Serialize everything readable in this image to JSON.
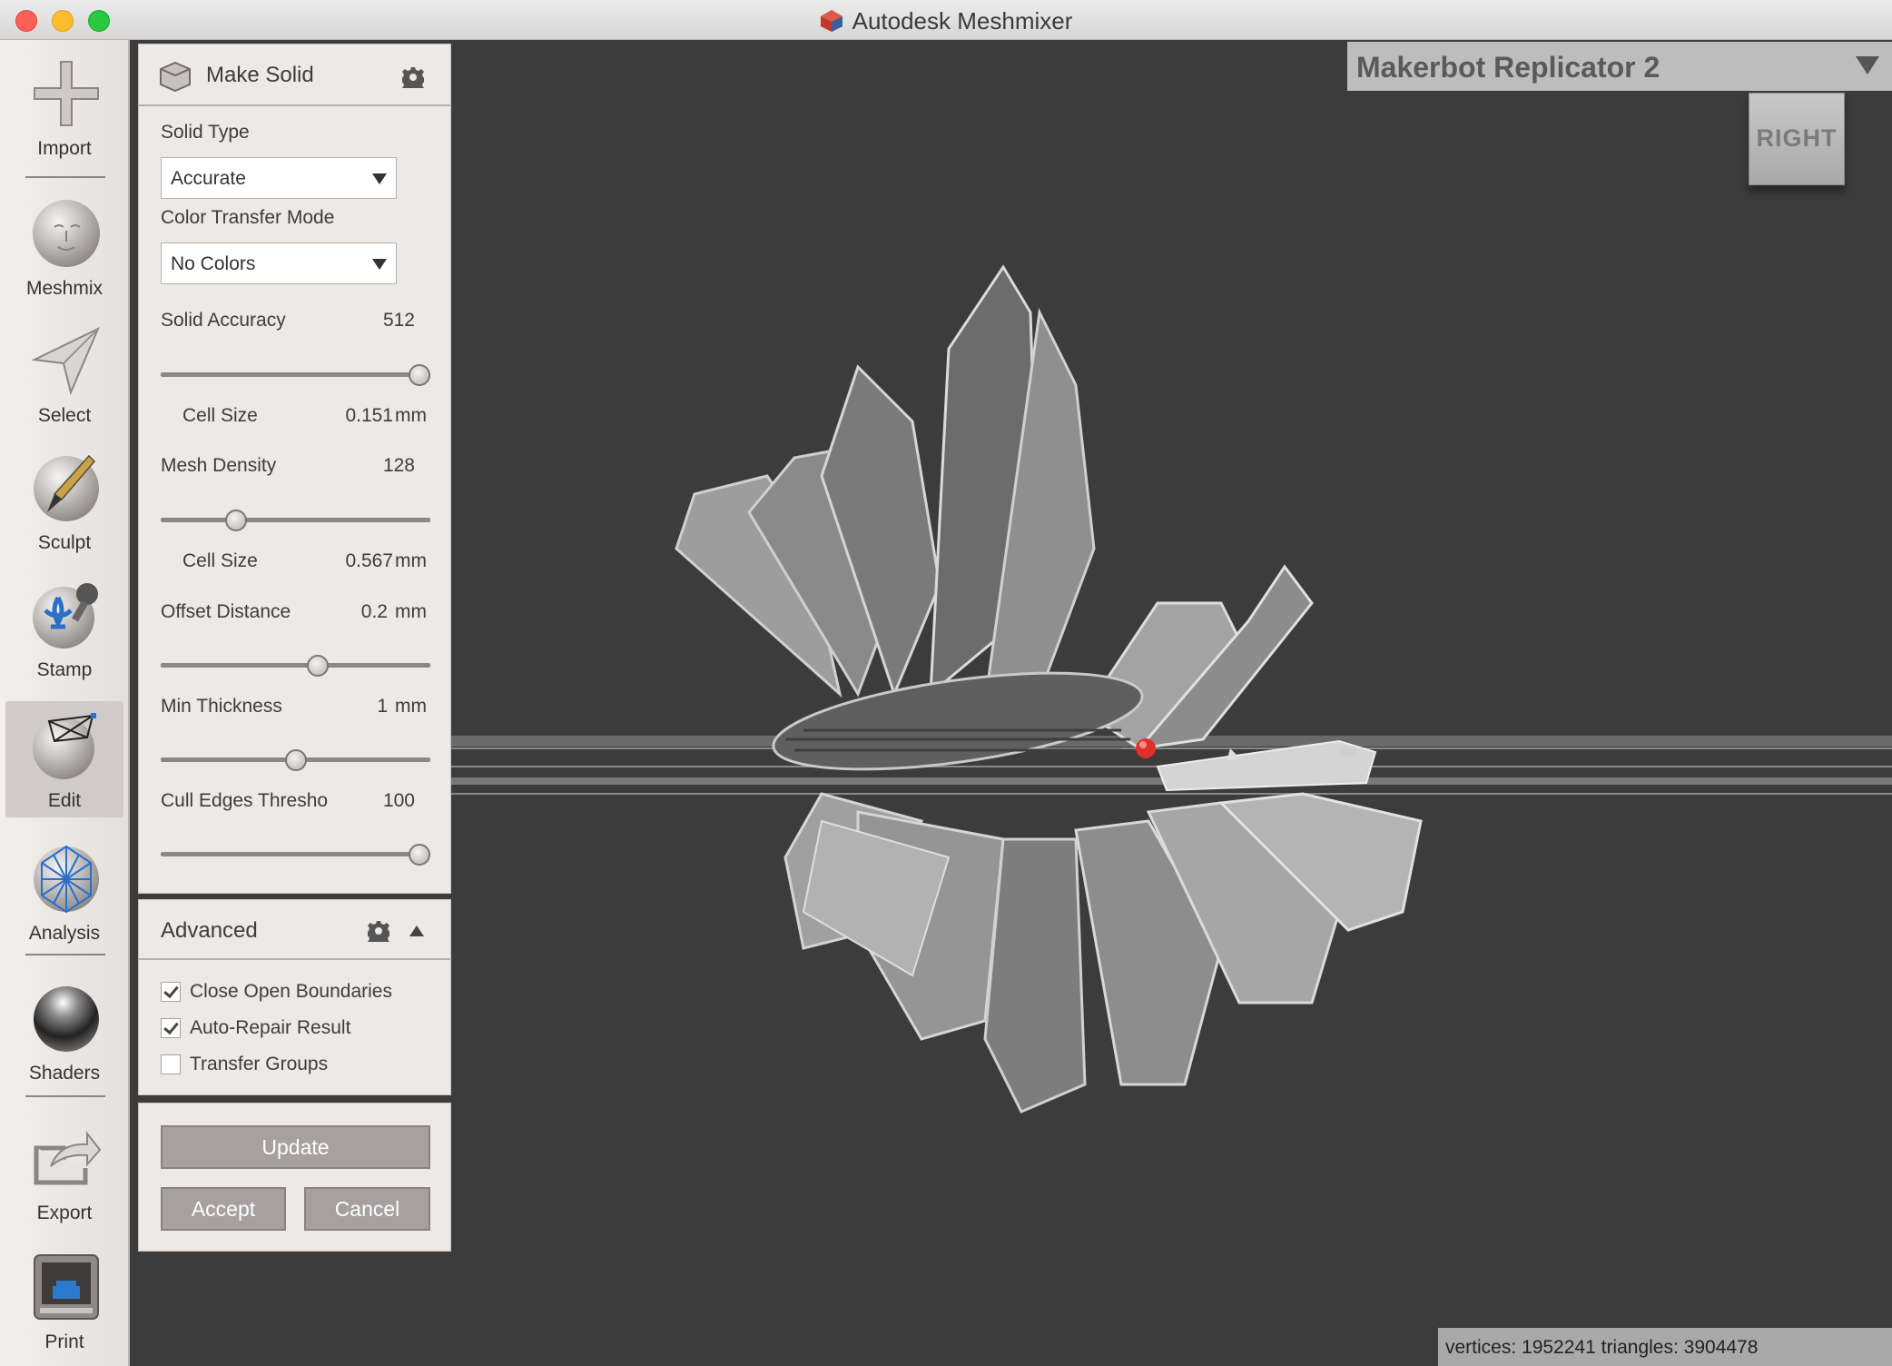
{
  "window": {
    "title": "Autodesk Meshmixer"
  },
  "toolbar": {
    "items": [
      {
        "label": "Import",
        "icon": "plus-icon"
      },
      {
        "label": "Meshmix",
        "icon": "head-sphere-icon"
      },
      {
        "label": "Select",
        "icon": "arrow-cursor-icon"
      },
      {
        "label": "Sculpt",
        "icon": "brush-sphere-icon"
      },
      {
        "label": "Stamp",
        "icon": "stamp-sphere-icon"
      },
      {
        "label": "Edit",
        "icon": "edit-sphere-icon"
      },
      {
        "label": "Analysis",
        "icon": "wireframe-sphere-icon"
      },
      {
        "label": "Shaders",
        "icon": "shader-sphere-icon"
      },
      {
        "label": "Export",
        "icon": "export-icon"
      },
      {
        "label": "Print",
        "icon": "printer-icon"
      }
    ],
    "active": "Edit"
  },
  "make_solid": {
    "title": "Make Solid",
    "solid_type_label": "Solid Type",
    "solid_type_value": "Accurate",
    "color_mode_label": "Color Transfer Mode",
    "color_mode_value": "No Colors",
    "solid_accuracy": {
      "label": "Solid Accuracy",
      "value": "512",
      "slider": 1.0
    },
    "cell_size_1": {
      "label": "Cell Size",
      "value": "0.151",
      "unit": "mm"
    },
    "mesh_density": {
      "label": "Mesh Density",
      "value": "128",
      "slider": 0.26
    },
    "cell_size_2": {
      "label": "Cell Size",
      "value": "0.567",
      "unit": "mm"
    },
    "offset_distance": {
      "label": "Offset Distance",
      "value": "0.2",
      "unit": "mm",
      "slider": 0.59
    },
    "min_thickness": {
      "label": "Min Thickness",
      "value": "1",
      "unit": "mm",
      "slider": 0.5
    },
    "cull_edges": {
      "label": "Cull Edges Thresho",
      "value": "100",
      "slider": 1.0
    }
  },
  "advanced": {
    "title": "Advanced",
    "options": [
      {
        "label": "Close Open Boundaries",
        "checked": true
      },
      {
        "label": "Auto-Repair Result",
        "checked": true
      },
      {
        "label": "Transfer Groups",
        "checked": false
      }
    ]
  },
  "actions": {
    "update": "Update",
    "accept": "Accept",
    "cancel": "Cancel"
  },
  "viewport": {
    "printer": "Makerbot Replicator 2",
    "view_cube": "RIGHT",
    "stats": "vertices: 1952241 triangles: 3904478"
  },
  "colors": {
    "viewport_bg": "#3c3c3c",
    "panel_bg": "#ece9e7",
    "button": "#a8a0a0",
    "accent_red": "#e0302a"
  }
}
